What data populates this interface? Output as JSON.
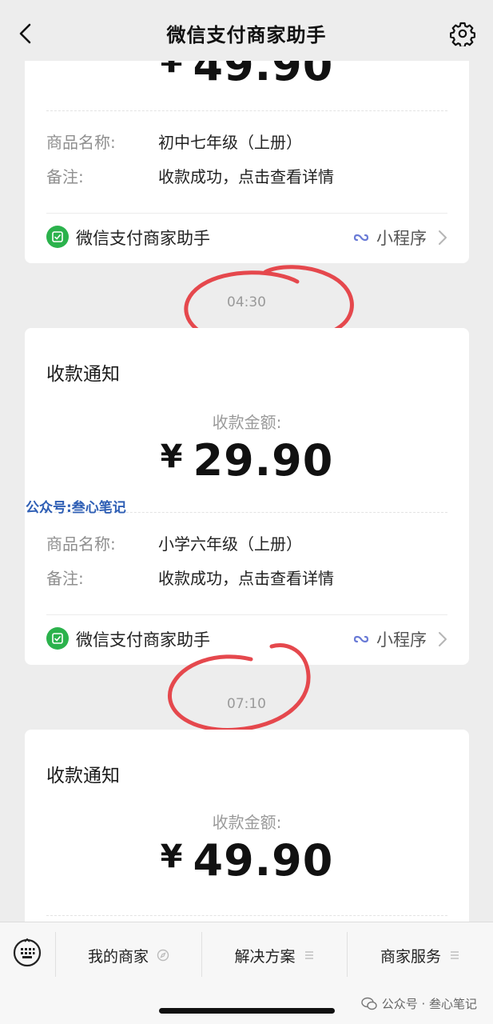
{
  "header": {
    "title": "微信支付商家助手"
  },
  "cards": [
    {
      "amount": "49.90",
      "product_label": "商品名称:",
      "product_value": "初中七年级（上册）",
      "note_label": "备注:",
      "note_value": "收款成功，点击查看详情",
      "brand_name": "微信支付商家助手",
      "mini_program": "小程序"
    },
    {
      "title": "收款通知",
      "amount_label": "收款金额:",
      "amount": "29.90",
      "product_label": "商品名称:",
      "product_value": "小学六年级（上册）",
      "note_label": "备注:",
      "note_value": "收款成功，点击查看详情",
      "brand_name": "微信支付商家助手",
      "mini_program": "小程序"
    },
    {
      "title": "收款通知",
      "amount_label": "收款金额:",
      "amount": "49.90"
    }
  ],
  "currency_symbol": "¥",
  "timestamps": [
    "04:30",
    "07:10"
  ],
  "watermark": "公众号:叁心笔记",
  "bottom_menu": [
    {
      "label": "我的商家",
      "icon": "compass-icon"
    },
    {
      "label": "解决方案",
      "icon": "menu-icon"
    },
    {
      "label": "商家服务",
      "icon": "menu-icon"
    }
  ],
  "footer_watermark": "公众号 · 叁心笔记",
  "colors": {
    "background": "#ededed",
    "card": "#ffffff",
    "brand_green": "#2bb24c",
    "annotation_red": "#e5484d",
    "watermark_blue": "#2f5fb5"
  }
}
